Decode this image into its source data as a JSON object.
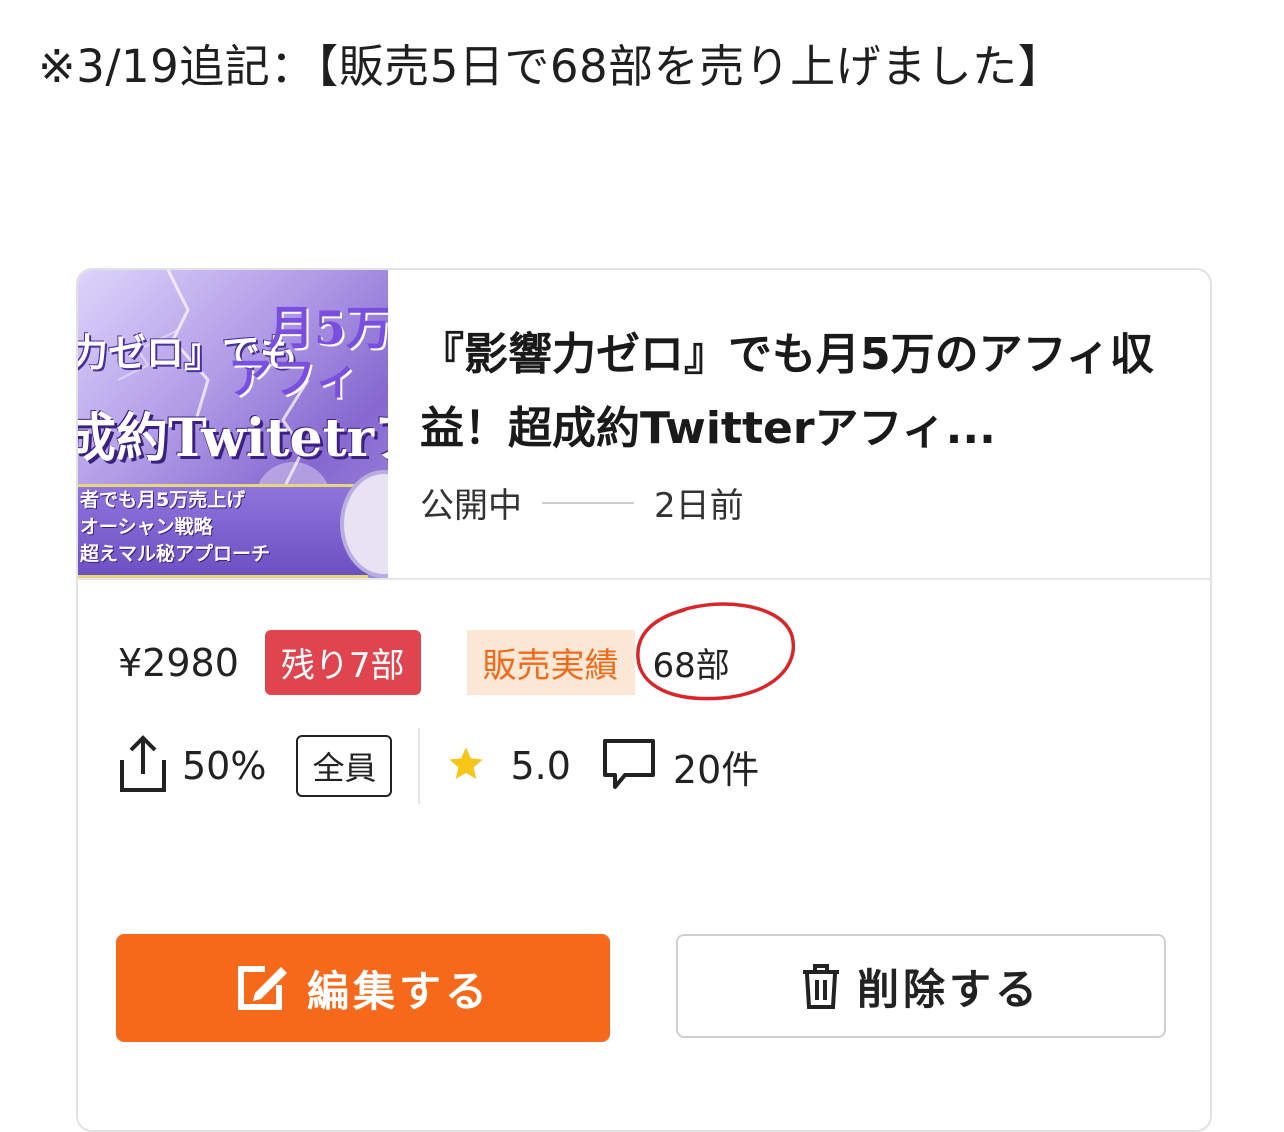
{
  "note": "※3/19追記：【販売5日で68部を売り上げました】",
  "card": {
    "thumbnail": {
      "line1": "力ゼロ』でも",
      "line2": "月5万",
      "line3": "アフィ",
      "line4": "成約Twitetrア",
      "band_lines": [
        "者でも月5万売上げ",
        "オーシャン戦略",
        "超えマル秘アプローチ"
      ]
    },
    "title": "『影響力ゼロ』でも月5万のアフィ収益！超成約Twitterアフィ...",
    "status": "公開中",
    "time_ago": "2日前",
    "price": "¥2980",
    "remaining": "残り7部",
    "sales_label": "販売実績",
    "sales_count": "68部",
    "affiliate_rate": "50%",
    "audience": "全員",
    "rating": "5.0",
    "review_count": "20件",
    "edit_label": "編集する",
    "delete_label": "削除する",
    "colors": {
      "accent": "#f6691a",
      "remain_badge": "#e0454f",
      "sales_label_bg": "#fde8d8",
      "sales_label_text": "#f06a1a",
      "star": "#f5c518",
      "annotation": "#d9262b"
    },
    "icons": {
      "share": "share-icon",
      "star": "star-icon",
      "comment": "comment-icon",
      "edit": "edit-icon",
      "trash": "trash-icon"
    }
  }
}
